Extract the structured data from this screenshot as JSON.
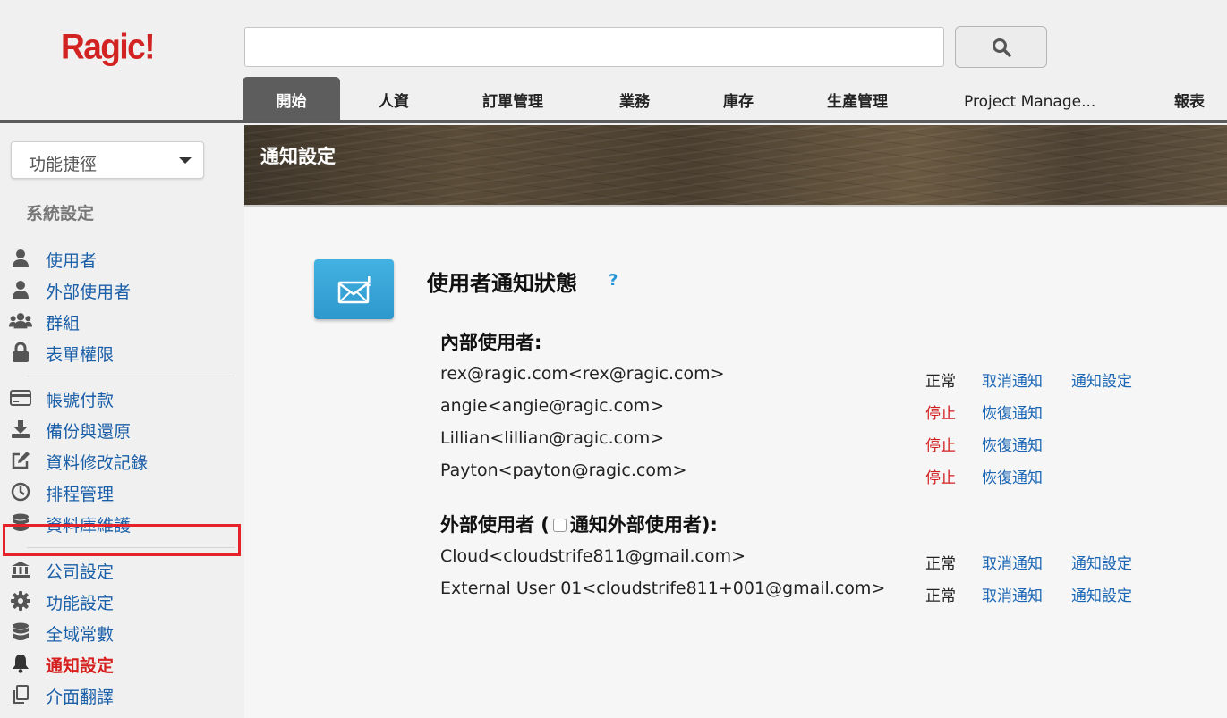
{
  "app": {
    "logo": "Ragic!"
  },
  "search": {
    "placeholder": ""
  },
  "nav": {
    "tabs": [
      "開始",
      "人資",
      "訂單管理",
      "業務",
      "庫存",
      "生產管理",
      "Project Manage...",
      "報表"
    ]
  },
  "sidebar": {
    "shortcut_label": "功能捷徑",
    "section_title": "系統設定",
    "items": [
      {
        "label": "使用者",
        "icon": "user-icon"
      },
      {
        "label": "外部使用者",
        "icon": "user-icon"
      },
      {
        "label": "群組",
        "icon": "users-icon"
      },
      {
        "label": "表單權限",
        "icon": "lock-icon"
      },
      {
        "label": "帳號付款",
        "icon": "credit-card-icon"
      },
      {
        "label": "備份與還原",
        "icon": "download-icon"
      },
      {
        "label": "資料修改記錄",
        "icon": "edit-icon"
      },
      {
        "label": "排程管理",
        "icon": "clock-icon"
      },
      {
        "label": "資料庫維護",
        "icon": "database-icon"
      },
      {
        "label": "公司設定",
        "icon": "bank-icon"
      },
      {
        "label": "功能設定",
        "icon": "gear-icon"
      },
      {
        "label": "全域常數",
        "icon": "database-icon"
      },
      {
        "label": "通知設定",
        "icon": "bell-icon",
        "active": true
      },
      {
        "label": "介面翻譯",
        "icon": "copy-icon"
      }
    ]
  },
  "banner": {
    "title": "通知設定"
  },
  "main": {
    "heading": "使用者通知狀態",
    "help": "?",
    "internal_title": "內部使用者:",
    "external_title_prefix": "外部使用者 (",
    "external_title_suffix": "通知外部使用者):",
    "internal_users": [
      {
        "name": "rex@ragic.com<rex@ragic.com>",
        "status": "正常",
        "action": "取消通知",
        "settings": "通知設定"
      },
      {
        "name": "angie<angie@ragic.com>",
        "status": "停止",
        "action": "恢復通知"
      },
      {
        "name": "Lillian<lillian@ragic.com>",
        "status": "停止",
        "action": "恢復通知"
      },
      {
        "name": "Payton<payton@ragic.com>",
        "status": "停止",
        "action": "恢復通知"
      }
    ],
    "external_users": [
      {
        "name": "Cloud<cloudstrife811@gmail.com>",
        "status": "正常",
        "action": "取消通知",
        "settings": "通知設定"
      },
      {
        "name": "External User 01<cloudstrife811+001@gmail.com>",
        "status": "正常",
        "action": "取消通知",
        "settings": "通知設定"
      }
    ]
  },
  "colors": {
    "brand": "#d22222",
    "link": "#1a5fa8",
    "stop": "#d11f1f",
    "active_highlight": "#e5222a"
  }
}
